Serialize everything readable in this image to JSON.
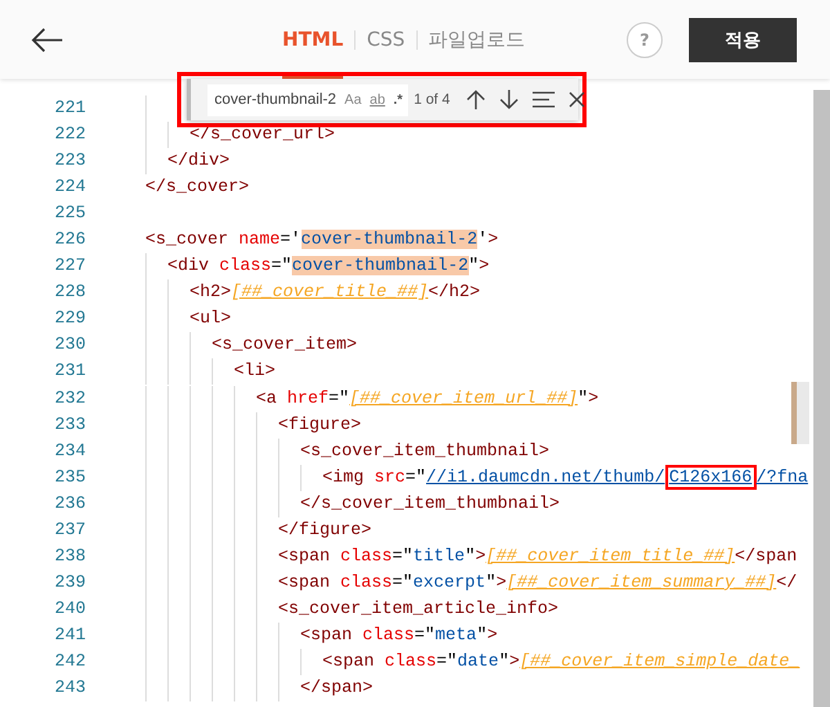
{
  "header": {
    "tabs": [
      {
        "label": "HTML",
        "selected": true
      },
      {
        "label": "CSS",
        "selected": false
      },
      {
        "label": "파일업로드",
        "selected": false
      }
    ],
    "help": "?",
    "apply_button": "적용"
  },
  "find_widget": {
    "query": "cover-thumbnail-2",
    "options": [
      "Aa",
      "ab",
      ".*"
    ],
    "match_count": "1 of 4"
  },
  "editor": {
    "lines": [
      {
        "children": [
          {
            "number": "221",
            "children": [
              {
                "number": "222",
                "tokens": [
                  {
                    "kind": "tag",
                    "text": "</s_cover_url>"
                  }
                ]
              }
            ]
          },
          {
            "number": "223",
            "tokens": [
              {
                "kind": "tag",
                "text": "</div>"
              }
            ]
          }
        ]
      },
      {
        "number": "224",
        "tokens": [
          {
            "kind": "tag",
            "text": "</s_cover>"
          }
        ]
      },
      {
        "number": "225"
      },
      {
        "number": "226",
        "tokens": [
          {
            "kind": "tag",
            "text": "<s_cover"
          },
          {
            "kind": "attr",
            "text": " name"
          },
          {
            "kind": "punct",
            "text": "='"
          },
          {
            "kind": "string",
            "text": "cover-thumbnail-2",
            "match": true
          },
          {
            "kind": "punct",
            "text": "'"
          },
          {
            "kind": "tag",
            "text": ">"
          }
        ],
        "children": [
          {
            "number": "227",
            "tokens": [
              {
                "kind": "tag",
                "text": "<div"
              },
              {
                "kind": "attr",
                "text": " class"
              },
              {
                "kind": "punct",
                "text": "=\""
              },
              {
                "kind": "string",
                "text": "cover-thumbnail-2",
                "match": true
              },
              {
                "kind": "punct",
                "text": "\""
              },
              {
                "kind": "tag",
                "text": ">"
              }
            ],
            "children": [
              {
                "number": "228",
                "tokens": [
                  {
                    "kind": "tag",
                    "text": "<h2>"
                  },
                  {
                    "kind": "template",
                    "text": "[##_cover_title_##]"
                  },
                  {
                    "kind": "tag",
                    "text": "</h2>"
                  }
                ]
              },
              {
                "number": "229",
                "tokens": [
                  {
                    "kind": "tag",
                    "text": "<ul>"
                  }
                ],
                "children": [
                  {
                    "number": "230",
                    "tokens": [
                      {
                        "kind": "tag",
                        "text": "<s_cover_item>"
                      }
                    ],
                    "children": [
                      {
                        "number": "231",
                        "tokens": [
                          {
                            "kind": "tag",
                            "text": "<li>"
                          }
                        ],
                        "children": [
                          {
                            "number": "232",
                            "tokens": [
                              {
                                "kind": "tag",
                                "text": "<a"
                              },
                              {
                                "kind": "attr",
                                "text": " href"
                              },
                              {
                                "kind": "punct",
                                "text": "=\""
                              },
                              {
                                "kind": "template",
                                "text": "[##_cover_item_url_##]"
                              },
                              {
                                "kind": "punct",
                                "text": "\""
                              },
                              {
                                "kind": "tag",
                                "text": ">"
                              }
                            ],
                            "children": [
                              {
                                "number": "233",
                                "tokens": [
                                  {
                                    "kind": "tag",
                                    "text": "<figure>"
                                  }
                                ],
                                "children": [
                                  {
                                    "number": "234",
                                    "tokens": [
                                      {
                                        "kind": "tag",
                                        "text": "<s_cover_item_thumbnail>"
                                      }
                                    ],
                                    "children": [
                                      {
                                        "number": "235",
                                        "tokens": [
                                          {
                                            "kind": "tag",
                                            "text": "<img"
                                          },
                                          {
                                            "kind": "attr",
                                            "text": " src"
                                          },
                                          {
                                            "kind": "punct",
                                            "text": "=\""
                                          },
                                          {
                                            "kind": "link",
                                            "text": "//i1.daumcdn.net/thumb/"
                                          },
                                          {
                                            "kind": "link",
                                            "text": "C126x166",
                                            "boxed": true
                                          },
                                          {
                                            "kind": "link",
                                            "text": "/?fna"
                                          }
                                        ]
                                      }
                                    ]
                                  },
                                  {
                                    "number": "236",
                                    "tokens": [
                                      {
                                        "kind": "tag",
                                        "text": "</s_cover_item_thumbnail>"
                                      }
                                    ]
                                  }
                                ]
                              },
                              {
                                "number": "237",
                                "tokens": [
                                  {
                                    "kind": "tag",
                                    "text": "</figure>"
                                  }
                                ]
                              },
                              {
                                "number": "238",
                                "tokens": [
                                  {
                                    "kind": "tag",
                                    "text": "<span"
                                  },
                                  {
                                    "kind": "attr",
                                    "text": " class"
                                  },
                                  {
                                    "kind": "punct",
                                    "text": "=\""
                                  },
                                  {
                                    "kind": "string",
                                    "text": "title"
                                  },
                                  {
                                    "kind": "punct",
                                    "text": "\""
                                  },
                                  {
                                    "kind": "tag",
                                    "text": ">"
                                  },
                                  {
                                    "kind": "template",
                                    "text": "[##_cover_item_title_##]"
                                  },
                                  {
                                    "kind": "tag",
                                    "text": "</span"
                                  }
                                ]
                              },
                              {
                                "number": "239",
                                "tokens": [
                                  {
                                    "kind": "tag",
                                    "text": "<span"
                                  },
                                  {
                                    "kind": "attr",
                                    "text": " class"
                                  },
                                  {
                                    "kind": "punct",
                                    "text": "=\""
                                  },
                                  {
                                    "kind": "string",
                                    "text": "excerpt"
                                  },
                                  {
                                    "kind": "punct",
                                    "text": "\""
                                  },
                                  {
                                    "kind": "tag",
                                    "text": ">"
                                  },
                                  {
                                    "kind": "template",
                                    "text": "[##_cover_item_summary_##]"
                                  },
                                  {
                                    "kind": "tag",
                                    "text": "</"
                                  }
                                ]
                              },
                              {
                                "number": "240",
                                "tokens": [
                                  {
                                    "kind": "tag",
                                    "text": "<s_cover_item_article_info>"
                                  }
                                ],
                                "children": [
                                  {
                                    "number": "241",
                                    "tokens": [
                                      {
                                        "kind": "tag",
                                        "text": "<span"
                                      },
                                      {
                                        "kind": "attr",
                                        "text": " class"
                                      },
                                      {
                                        "kind": "punct",
                                        "text": "=\""
                                      },
                                      {
                                        "kind": "string",
                                        "text": "meta"
                                      },
                                      {
                                        "kind": "punct",
                                        "text": "\""
                                      },
                                      {
                                        "kind": "tag",
                                        "text": ">"
                                      }
                                    ],
                                    "children": [
                                      {
                                        "number": "242",
                                        "tokens": [
                                          {
                                            "kind": "tag",
                                            "text": "<span"
                                          },
                                          {
                                            "kind": "attr",
                                            "text": " class"
                                          },
                                          {
                                            "kind": "punct",
                                            "text": "=\""
                                          },
                                          {
                                            "kind": "string",
                                            "text": "date"
                                          },
                                          {
                                            "kind": "punct",
                                            "text": "\""
                                          },
                                          {
                                            "kind": "tag",
                                            "text": ">"
                                          },
                                          {
                                            "kind": "template",
                                            "text": "[##_cover_item_simple_date_"
                                          }
                                        ]
                                      }
                                    ]
                                  },
                                  {
                                    "number": "243",
                                    "tokens": [
                                      {
                                        "kind": "tag",
                                        "text": "</span>"
                                      }
                                    ]
                                  }
                                ]
                              }
                            ]
                          }
                        ]
                      }
                    ]
                  }
                ]
              }
            ]
          }
        ]
      }
    ]
  }
}
